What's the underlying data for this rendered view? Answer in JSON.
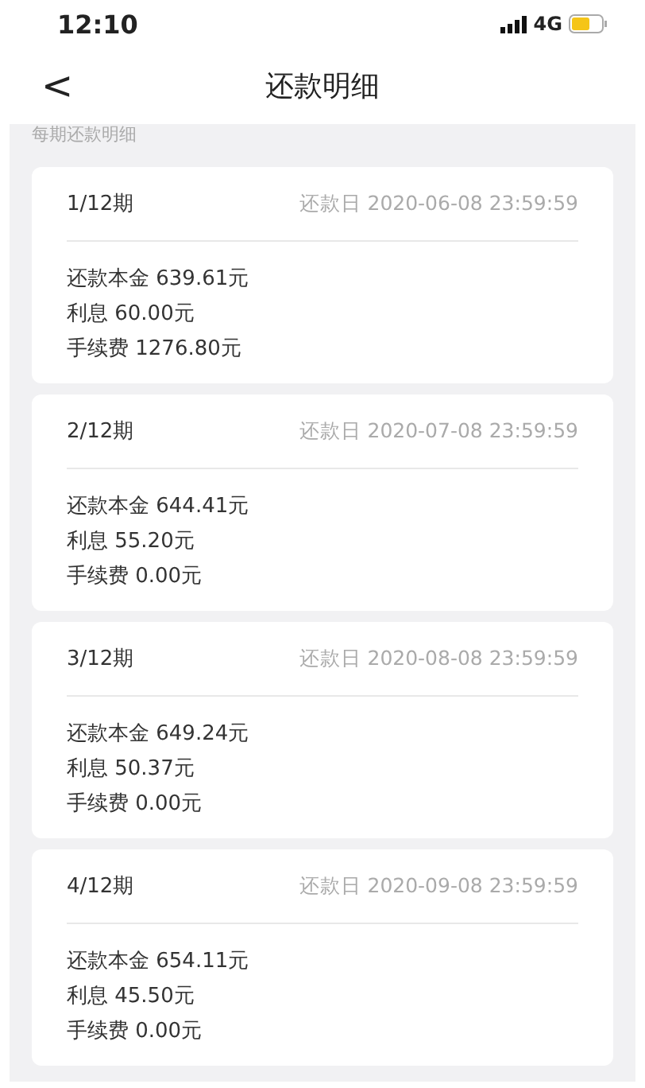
{
  "status_bar": {
    "time": "12:10",
    "network": "4G"
  },
  "nav": {
    "back": "<",
    "title": "还款明细"
  },
  "section_label": "每期还款明细",
  "periods": [
    {
      "period": "1/12期",
      "due_date": "还款日 2020-06-08 23:59:59",
      "lines": [
        "还款本金 639.61元",
        "利息 60.00元",
        "手续费 1276.80元"
      ]
    },
    {
      "period": "2/12期",
      "due_date": "还款日 2020-07-08 23:59:59",
      "lines": [
        "还款本金 644.41元",
        "利息 55.20元",
        "手续费 0.00元"
      ]
    },
    {
      "period": "3/12期",
      "due_date": "还款日 2020-08-08 23:59:59",
      "lines": [
        "还款本金 649.24元",
        "利息 50.37元",
        "手续费 0.00元"
      ]
    },
    {
      "period": "4/12期",
      "due_date": "还款日 2020-09-08 23:59:59",
      "lines": [
        "还款本金 654.11元",
        "利息 45.50元",
        "手续费 0.00元"
      ]
    }
  ]
}
